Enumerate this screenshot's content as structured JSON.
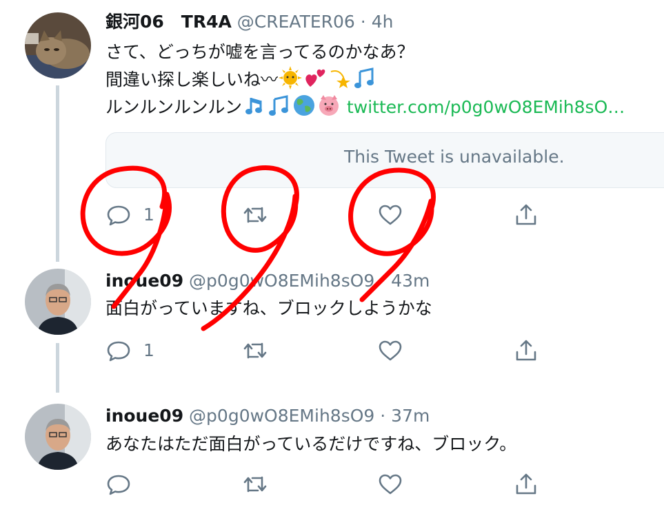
{
  "tweets": [
    {
      "name": "銀河06　TR4A",
      "handle": "@CREATER06",
      "dot": "·",
      "time": "4h",
      "line1": "さて、どっちが嘘を言ってるのかなあ？",
      "line2": "間違い探し楽しいね〰",
      "line3": "ルンルンルンルン",
      "link": "twitter.com/p0g0wO8EMih8sO…",
      "quote": "This Tweet is unavailable.",
      "reply_count": "1"
    },
    {
      "name": "inoue09",
      "handle": "@p0g0wO8EMih8sO9",
      "dot": "·",
      "time": "43m",
      "text": "面白がっていますね、ブロックしようかな",
      "reply_count": "1"
    },
    {
      "name": "inoue09",
      "handle": "@p0g0wO8EMih8sO9",
      "dot": "·",
      "time": "37m",
      "text": "あなたはただ面白がっているだけですね、ブロック。",
      "reply_count": ""
    }
  ],
  "icons": {
    "reply": "reply-icon",
    "retweet": "retweet-icon",
    "like": "heart-icon",
    "share": "share-icon"
  },
  "colors": {
    "link": "#1ab954",
    "secondary": "#657786",
    "thread_line": "#ccd6dd",
    "annotation": "#ff0000"
  }
}
